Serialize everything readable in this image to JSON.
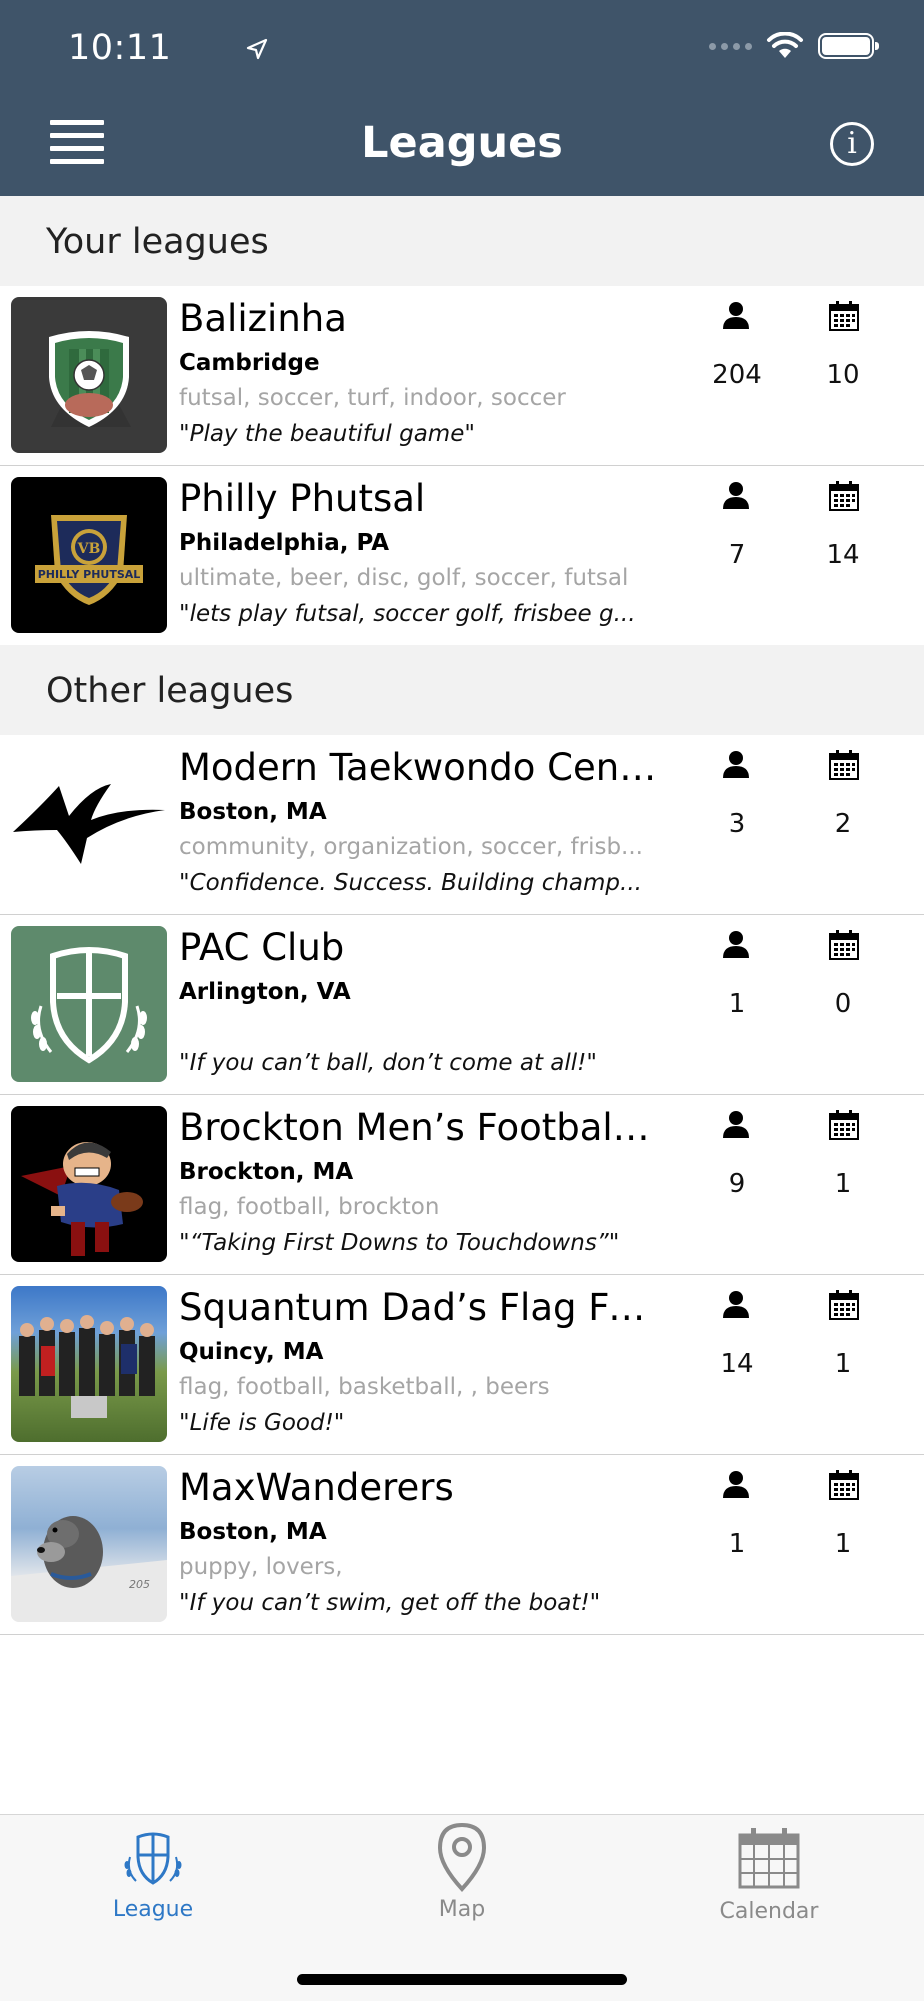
{
  "status_bar": {
    "time": "10:11"
  },
  "header": {
    "title": "Leagues"
  },
  "sections": {
    "yours": "Your leagues",
    "other": "Other leagues"
  },
  "your_leagues": [
    {
      "name": "Balizinha",
      "city": "Cambridge",
      "tags": "futsal, soccer, turf, indoor, soccer",
      "motto": "\"Play the beautiful game\"",
      "members": "204",
      "events": "10"
    },
    {
      "name": "Philly Phutsal",
      "city": "Philadelphia, PA",
      "tags": "ultimate, beer, disc, golf, soccer, futsal",
      "motto": "\"lets play futsal, soccer golf, frisbee g...",
      "members": "7",
      "events": "14",
      "logo_text": "PHILLY PHUTSAL"
    }
  ],
  "other_leagues": [
    {
      "name": "Modern Taekwondo Center",
      "city": "Boston, MA",
      "tags": "community, organization, soccer, frisb...",
      "motto": "\"Confidence. Success. Building champ...",
      "members": "3",
      "events": "2"
    },
    {
      "name": "PAC Club",
      "city": "Arlington, VA",
      "tags": "",
      "motto": "\"If you can’t ball, don’t come at all!\"",
      "members": "1",
      "events": "0"
    },
    {
      "name": "Brockton Men’s Football L...",
      "city": "Brockton, MA",
      "tags": "flag, football, brockton",
      "motto": "\"“Taking First Downs to Touchdowns”\"",
      "members": "9",
      "events": "1"
    },
    {
      "name": "Squantum Dad’s Flag Foo...",
      "city": "Quincy, MA",
      "tags": "flag, football, basketball, , beers",
      "motto": "\"Life is Good!\"",
      "members": "14",
      "events": "1"
    },
    {
      "name": "MaxWanderers",
      "city": "Boston, MA",
      "tags": "puppy, lovers,",
      "motto": "\"If you can’t swim, get off the boat!\"",
      "members": "1",
      "events": "1"
    }
  ],
  "tabs": [
    {
      "label": "League",
      "icon": "shield-icon",
      "active": true
    },
    {
      "label": "Map",
      "icon": "map-pin-icon",
      "active": false
    },
    {
      "label": "Calendar",
      "icon": "calendar-icon",
      "active": false
    }
  ],
  "colors": {
    "header": "#3f5469",
    "accent": "#2e78c6",
    "section_bg": "#f2f2f2"
  }
}
